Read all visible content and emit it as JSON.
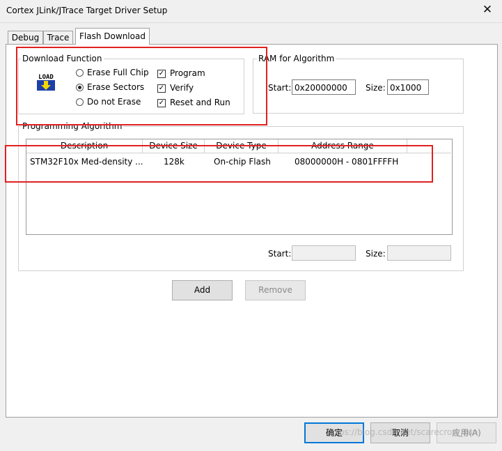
{
  "window": {
    "title": "Cortex JLink/JTrace Target Driver Setup",
    "close_glyph": "✕"
  },
  "tabs": [
    {
      "label": "Debug"
    },
    {
      "label": "Trace"
    },
    {
      "label": "Flash Download"
    }
  ],
  "download_function": {
    "title": "Download Function",
    "icon_text": "LOAD",
    "icon": "load-download-icon",
    "radios": [
      {
        "label": "Erase Full Chip",
        "checked": false
      },
      {
        "label": "Erase Sectors",
        "checked": true
      },
      {
        "label": "Do not Erase",
        "checked": false
      }
    ],
    "checkboxes": [
      {
        "label": "Program",
        "checked": true
      },
      {
        "label": "Verify",
        "checked": true
      },
      {
        "label": "Reset and Run",
        "checked": true
      }
    ]
  },
  "ram_for_algorithm": {
    "title": "RAM for Algorithm",
    "start_label": "Start:",
    "start_value": "0x20000000",
    "size_label": "Size:",
    "size_value": "0x1000"
  },
  "programming_algorithm": {
    "title": "Programming Algorithm",
    "columns": [
      "Description",
      "Device Size",
      "Device Type",
      "Address Range"
    ],
    "rows": [
      {
        "description": "STM32F10x Med-density ...",
        "device_size": "128k",
        "device_type": "On-chip Flash",
        "address_range": "08000000H - 0801FFFFH"
      }
    ],
    "start_label": "Start:",
    "start_value": "",
    "size_label": "Size:",
    "size_value": ""
  },
  "buttons": {
    "add": "Add",
    "remove": "Remove",
    "ok": "确定",
    "cancel": "取消",
    "apply": "应用(A)"
  },
  "watermark": "https://blog.csdn.net/scarecrow_sun",
  "colors": {
    "annotation_red": "#e02020",
    "default_button_border": "#0078d7"
  }
}
